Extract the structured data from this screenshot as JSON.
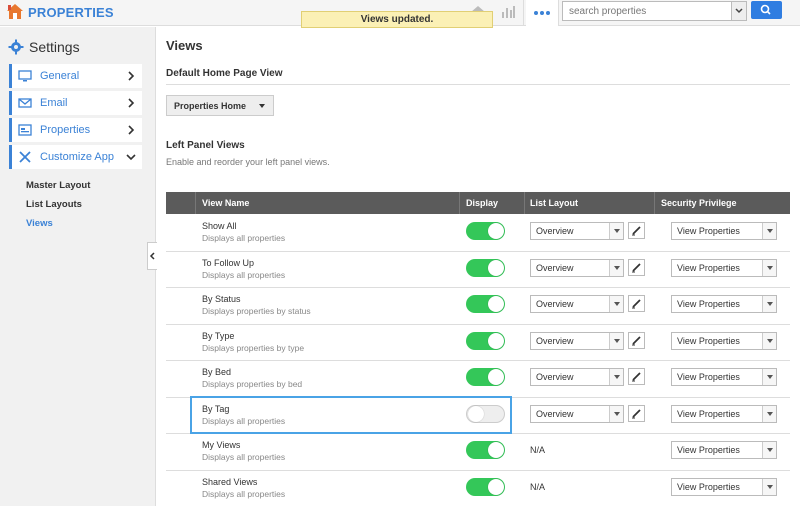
{
  "app": {
    "brand": "PROPERTIES",
    "brand_color": "#3b82d6",
    "toast": "Views updated."
  },
  "search": {
    "placeholder": "search properties"
  },
  "sidebar": {
    "title": "Settings",
    "items": [
      {
        "label": "General",
        "icon": "monitor-icon",
        "chevron": "chevron-right-icon"
      },
      {
        "label": "Email",
        "icon": "envelope-icon",
        "chevron": "chevron-right-icon"
      },
      {
        "label": "Properties",
        "icon": "properties-icon",
        "chevron": "chevron-right-icon"
      },
      {
        "label": "Customize App",
        "icon": "tools-icon",
        "chevron": "chevron-down-icon"
      }
    ],
    "sub_items": [
      {
        "label": "Master Layout",
        "active": false
      },
      {
        "label": "List Layouts",
        "active": false
      },
      {
        "label": "Views",
        "active": true
      }
    ]
  },
  "main": {
    "title": "Views",
    "default_home_heading": "Default Home Page View",
    "default_home_value": "Properties Home",
    "left_panel_heading": "Left Panel Views",
    "left_panel_desc": "Enable and reorder your left panel views."
  },
  "table": {
    "columns": [
      "View Name",
      "Display",
      "List Layout",
      "Security Privilege"
    ],
    "rows": [
      {
        "name": "Show All",
        "desc": "Displays all properties",
        "display": true,
        "layout": "Overview",
        "security": "View Properties"
      },
      {
        "name": "To Follow Up",
        "desc": "Displays all properties",
        "display": true,
        "layout": "Overview",
        "security": "View Properties"
      },
      {
        "name": "By Status",
        "desc": "Displays properties by status",
        "display": true,
        "layout": "Overview",
        "security": "View Properties"
      },
      {
        "name": "By Type",
        "desc": "Displays properties by type",
        "display": true,
        "layout": "Overview",
        "security": "View Properties"
      },
      {
        "name": "By Bed",
        "desc": "Displays properties by bed",
        "display": true,
        "layout": "Overview",
        "security": "View Properties"
      },
      {
        "name": "By Tag",
        "desc": "Displays all properties",
        "display": false,
        "layout": "Overview",
        "security": "View Properties"
      },
      {
        "name": "My Views",
        "desc": "Displays all properties",
        "display": true,
        "layout": "N/A",
        "security": "View Properties"
      },
      {
        "name": "Shared Views",
        "desc": "Displays all properties",
        "display": true,
        "layout": "N/A",
        "security": "View Properties"
      }
    ]
  },
  "colors": {
    "accent": "#3b82d6",
    "toggle_on": "#34c759",
    "highlight": "#4aa3e6",
    "header_bg": "#5b5b5b"
  }
}
